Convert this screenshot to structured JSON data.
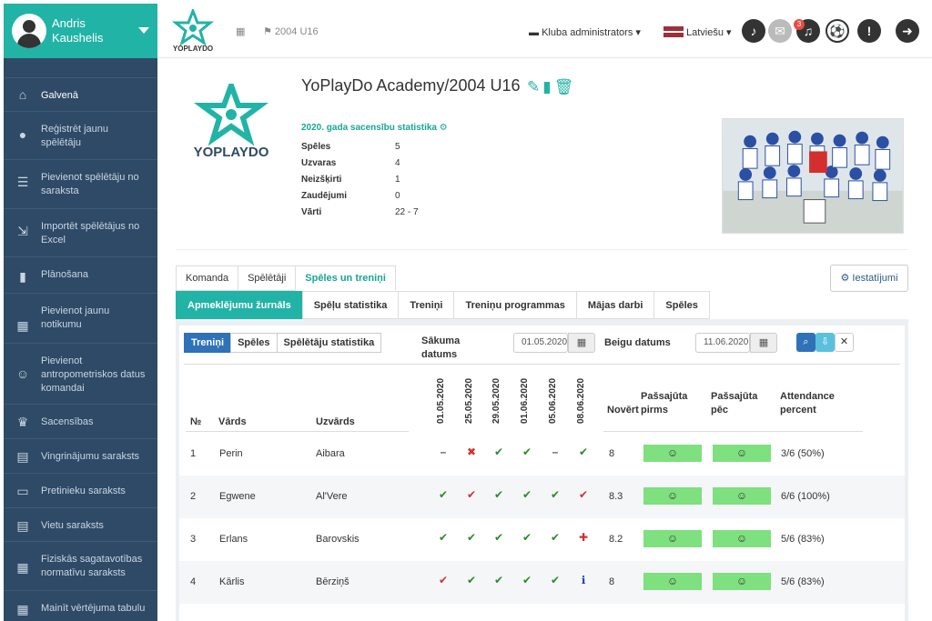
{
  "user": {
    "first_name": "Andris",
    "last_name": "Kaushelis"
  },
  "sidebar": {
    "items": [
      {
        "label": "Galvenā",
        "icon": "home-icon",
        "glyph": "⌂"
      },
      {
        "label": "Reģistrēt jaunu spēlētāju",
        "icon": "user-icon",
        "glyph": "●"
      },
      {
        "label": "Pievienot spēlētāju no saraksta",
        "icon": "list-icon",
        "glyph": "☰"
      },
      {
        "label": "Importēt spēlētājus no Excel",
        "icon": "import-icon",
        "glyph": "⇲"
      },
      {
        "label": "Plānošana",
        "icon": "book-icon",
        "glyph": "▮"
      },
      {
        "label": "Pievienot jaunu notikumu",
        "icon": "calendar-icon",
        "glyph": "▦"
      },
      {
        "label": "Pievienot antropometriskos datus komandai",
        "icon": "person-icon",
        "glyph": "☺"
      },
      {
        "label": "Sacensības",
        "icon": "trophy-icon",
        "glyph": "♛"
      },
      {
        "label": "Vingrinājumu saraksts",
        "icon": "list-alt-icon",
        "glyph": "▤"
      },
      {
        "label": "Pretinieku saraksts",
        "icon": "id-card-icon",
        "glyph": "▭"
      },
      {
        "label": "Vietu saraksts",
        "icon": "list-alt-icon",
        "glyph": "▤"
      },
      {
        "label": "Fiziskās sagatavotības normatīvu saraksts",
        "icon": "grid-icon",
        "glyph": "▦"
      },
      {
        "label": "Mainīt vērtējuma tabulu",
        "icon": "grid-icon",
        "glyph": "▦"
      }
    ]
  },
  "header": {
    "logo_text": "YOPLAYDO",
    "breadcrumb": "2004 U16",
    "role": "Kluba administrators",
    "language": "Latviešu",
    "notification_count": "3"
  },
  "team": {
    "title": "YoPlayDo Academy/2004 U16",
    "logo_text": "YOPLAYDO",
    "stats_title": "2020. gada sacensību statistika",
    "stats": [
      {
        "label": "Spēles",
        "value": "5"
      },
      {
        "label": "Uzvaras",
        "value": "4"
      },
      {
        "label": "Neizšķirti",
        "value": "1"
      },
      {
        "label": "Zaudējumi",
        "value": "0"
      },
      {
        "label": "Vārti",
        "value": "22 - 7"
      }
    ]
  },
  "tabs": [
    "Komanda",
    "Spēlētāji",
    "Spēles un treniņi"
  ],
  "settings_label": "Iestatījumi",
  "subtabs": [
    "Apmeklējumu žurnāls",
    "Spēļu statistika",
    "Treniņi",
    "Treniņu programmas",
    "Mājas darbi",
    "Spēles"
  ],
  "filter": {
    "segments": [
      "Treniņi",
      "Spēles",
      "Spēlētāju statistika"
    ],
    "start_label_1": "Sākuma",
    "start_label_2": "datums",
    "start_value": "01.05.2020",
    "end_label": "Beigu datums",
    "end_value": "11.06.2020"
  },
  "table": {
    "headers": {
      "nr": "№",
      "name": "Vārds",
      "surname": "Uzvārds",
      "dates": [
        "01.05.2020",
        "25.05.2020",
        "29.05.2020",
        "01.06.2020",
        "05.06.2020",
        "08.06.2020"
      ],
      "rating": "Novērt",
      "self_before_1": "Pašsajūta",
      "self_before_2": "pirms",
      "self_after_1": "Pašsajūta",
      "self_after_2": "pēc",
      "attendance_1": "Attendance",
      "attendance_2": "percent"
    },
    "rows": [
      {
        "nr": "1",
        "name": "Perin",
        "surname": "Aibara",
        "marks": [
          "dash",
          "x",
          "check",
          "check",
          "dash",
          "check"
        ],
        "rating": "8",
        "attendance": "3/6 (50%)"
      },
      {
        "nr": "2",
        "name": "Egwene",
        "surname": "Al'Vere",
        "marks": [
          "check",
          "check-red",
          "check",
          "check",
          "check",
          "check-red"
        ],
        "rating": "8.3",
        "attendance": "6/6 (100%)"
      },
      {
        "nr": "3",
        "name": "Erlans",
        "surname": "Barovskis",
        "marks": [
          "check",
          "check",
          "check",
          "check",
          "check",
          "ambulance"
        ],
        "rating": "8.2",
        "attendance": "5/6 (83%)"
      },
      {
        "nr": "4",
        "name": "Kārlis",
        "surname": "Bērziņš",
        "marks": [
          "check-red",
          "check",
          "check",
          "check",
          "check",
          "info"
        ],
        "rating": "8",
        "attendance": "5/6 (83%)"
      }
    ]
  }
}
